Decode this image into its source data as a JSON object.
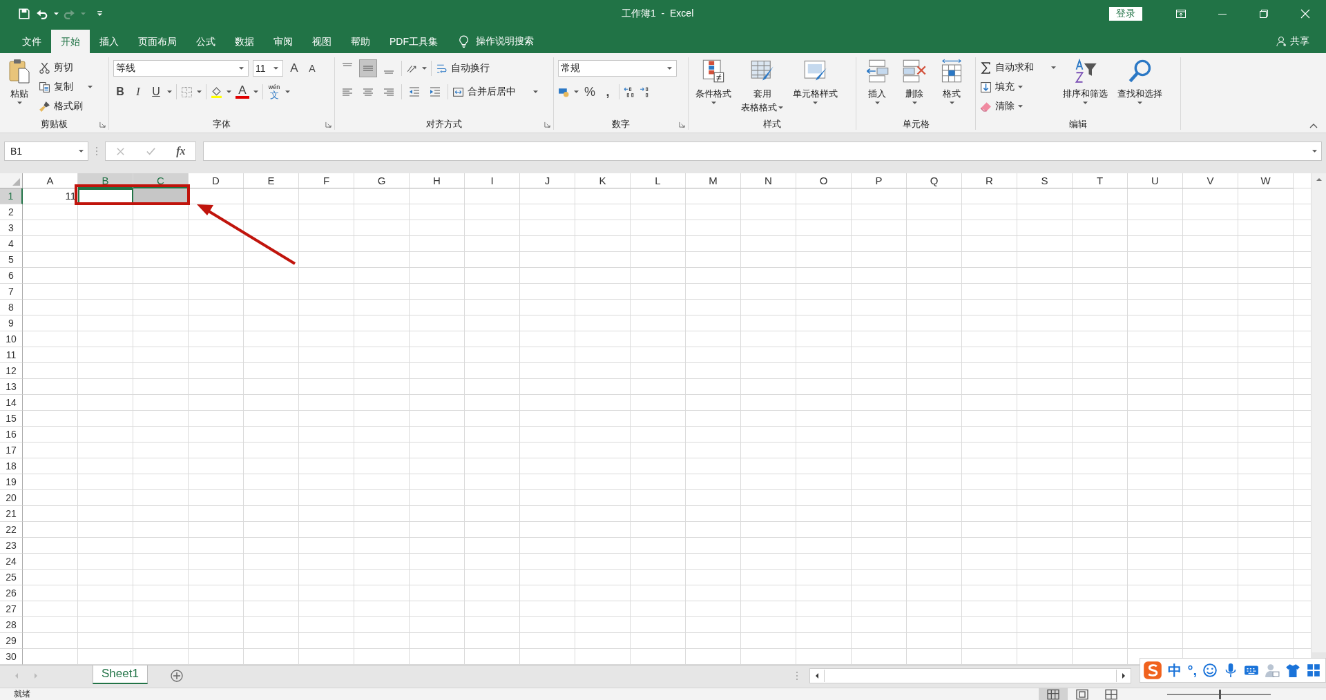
{
  "window": {
    "title": "工作簿1  -  Excel",
    "sign_in": "登录"
  },
  "tabs": [
    {
      "label": "文件",
      "selected": false
    },
    {
      "label": "开始",
      "selected": true
    },
    {
      "label": "插入",
      "selected": false
    },
    {
      "label": "页面布局",
      "selected": false
    },
    {
      "label": "公式",
      "selected": false
    },
    {
      "label": "数据",
      "selected": false
    },
    {
      "label": "审阅",
      "selected": false
    },
    {
      "label": "视图",
      "selected": false
    },
    {
      "label": "帮助",
      "selected": false
    },
    {
      "label": "PDF工具集",
      "selected": false
    }
  ],
  "tell_me": "操作说明搜索",
  "share": "共享",
  "ribbon": {
    "clipboard": {
      "label": "剪贴板",
      "paste": "粘贴",
      "cut": "剪切",
      "copy": "复制",
      "format_painter": "格式刷"
    },
    "font": {
      "label": "字体",
      "font_name": "等线",
      "font_size": "11",
      "grow": "A",
      "shrink": "A",
      "bold": "B",
      "italic": "I",
      "underline": "U",
      "font_color": "A",
      "phonetic_top": "wén",
      "phonetic": "文"
    },
    "alignment": {
      "label": "对齐方式",
      "vertical_buttons": [
        {
          "selected": false
        },
        {
          "selected": true
        },
        {
          "selected": false
        }
      ],
      "wrap_text": "自动换行",
      "merge_center": "合并后居中"
    },
    "number": {
      "label": "数字",
      "format": "常规",
      "percent": "%",
      "comma": ","
    },
    "styles": {
      "label": "样式",
      "conditional": "条件格式",
      "table_top": "套用",
      "table_bottom": "表格格式",
      "cell_styles": "单元格样式"
    },
    "cells": {
      "label": "单元格",
      "insert": "插入",
      "delete": "删除",
      "format": "格式"
    },
    "editing": {
      "label": "编辑",
      "autosum": "自动求和",
      "fill": "填充",
      "clear": "清除",
      "sort": "排序和筛选",
      "find": "查找和选择"
    }
  },
  "formula_bar": {
    "name_box": "B1",
    "function_label": "fx"
  },
  "sheet": {
    "columns": [
      {
        "label": "A",
        "selected": false
      },
      {
        "label": "B",
        "selected": true
      },
      {
        "label": "C",
        "selected": true
      },
      {
        "label": "D",
        "selected": false
      },
      {
        "label": "E",
        "selected": false
      },
      {
        "label": "F",
        "selected": false
      },
      {
        "label": "G",
        "selected": false
      },
      {
        "label": "H",
        "selected": false
      },
      {
        "label": "I",
        "selected": false
      },
      {
        "label": "J",
        "selected": false
      },
      {
        "label": "K",
        "selected": false
      },
      {
        "label": "L",
        "selected": false
      },
      {
        "label": "M",
        "selected": false
      },
      {
        "label": "N",
        "selected": false
      },
      {
        "label": "O",
        "selected": false
      },
      {
        "label": "P",
        "selected": false
      },
      {
        "label": "Q",
        "selected": false
      },
      {
        "label": "R",
        "selected": false
      },
      {
        "label": "S",
        "selected": false
      },
      {
        "label": "T",
        "selected": false
      },
      {
        "label": "U",
        "selected": false
      },
      {
        "label": "V",
        "selected": false
      },
      {
        "label": "W",
        "selected": false
      }
    ],
    "rows": [
      {
        "label": "1",
        "selected": true,
        "cells": [
          {
            "value": "11",
            "selected": false,
            "active": false
          },
          {
            "selected": true,
            "active": true
          },
          {
            "selected": true,
            "active": false
          }
        ]
      },
      {
        "label": "2",
        "selected": false
      },
      {
        "label": "3",
        "selected": false
      },
      {
        "label": "4",
        "selected": false
      },
      {
        "label": "5",
        "selected": false
      },
      {
        "label": "6",
        "selected": false
      },
      {
        "label": "7",
        "selected": false
      },
      {
        "label": "8",
        "selected": false
      },
      {
        "label": "9",
        "selected": false
      },
      {
        "label": "10",
        "selected": false
      },
      {
        "label": "11",
        "selected": false
      },
      {
        "label": "12",
        "selected": false
      },
      {
        "label": "13",
        "selected": false
      },
      {
        "label": "14",
        "selected": false
      },
      {
        "label": "15",
        "selected": false
      },
      {
        "label": "16",
        "selected": false
      },
      {
        "label": "17",
        "selected": false
      },
      {
        "label": "18",
        "selected": false
      },
      {
        "label": "19",
        "selected": false
      },
      {
        "label": "20",
        "selected": false
      },
      {
        "label": "21",
        "selected": false
      },
      {
        "label": "22",
        "selected": false
      },
      {
        "label": "23",
        "selected": false
      },
      {
        "label": "24",
        "selected": false
      },
      {
        "label": "25",
        "selected": false
      },
      {
        "label": "26",
        "selected": false
      },
      {
        "label": "27",
        "selected": false
      },
      {
        "label": "28",
        "selected": false
      },
      {
        "label": "29",
        "selected": false
      },
      {
        "label": "30",
        "selected": false
      }
    ]
  },
  "sheet_tabs": [
    {
      "label": "Sheet1",
      "selected": true
    }
  ],
  "status_bar": {
    "text": "就绪",
    "zoom": {
      "level": 0.5
    }
  },
  "ime": {
    "mode": "中",
    "punctuation": "°,"
  }
}
